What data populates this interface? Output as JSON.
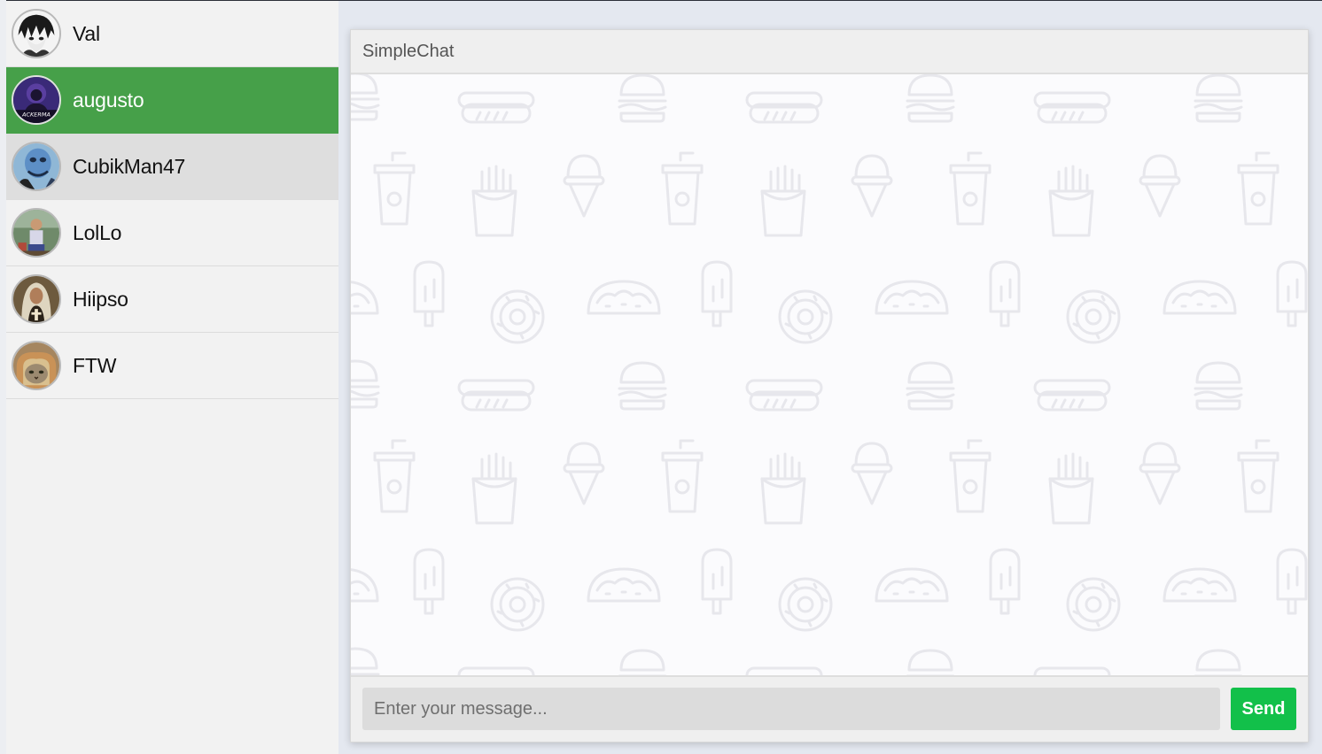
{
  "contacts": [
    {
      "name": "Val",
      "avatar": "anime-portrait",
      "state": "normal"
    },
    {
      "name": "augusto",
      "avatar": "hacker-portrait",
      "state": "active"
    },
    {
      "name": "CubikMan47",
      "avatar": "blue-character",
      "state": "hover"
    },
    {
      "name": "LolLo",
      "avatar": "outdoor-person",
      "state": "normal"
    },
    {
      "name": "Hiipso",
      "avatar": "nun-figure",
      "state": "normal"
    },
    {
      "name": "FTW",
      "avatar": "cat-in-bread",
      "state": "normal"
    }
  ],
  "chat": {
    "title": "SimpleChat",
    "input_placeholder": "Enter your message...",
    "send_label": "Send"
  },
  "colors": {
    "active_contact": "#46a049",
    "hover_contact": "#dedede",
    "send_button": "#12c04a",
    "sidebar_bg": "#f2f2f2"
  },
  "background_pattern_icons": [
    "burger-icon",
    "hotdog-icon",
    "soda-cup-icon",
    "ice-cream-icon",
    "fries-icon",
    "popsicle-icon",
    "donut-icon",
    "taco-icon"
  ]
}
